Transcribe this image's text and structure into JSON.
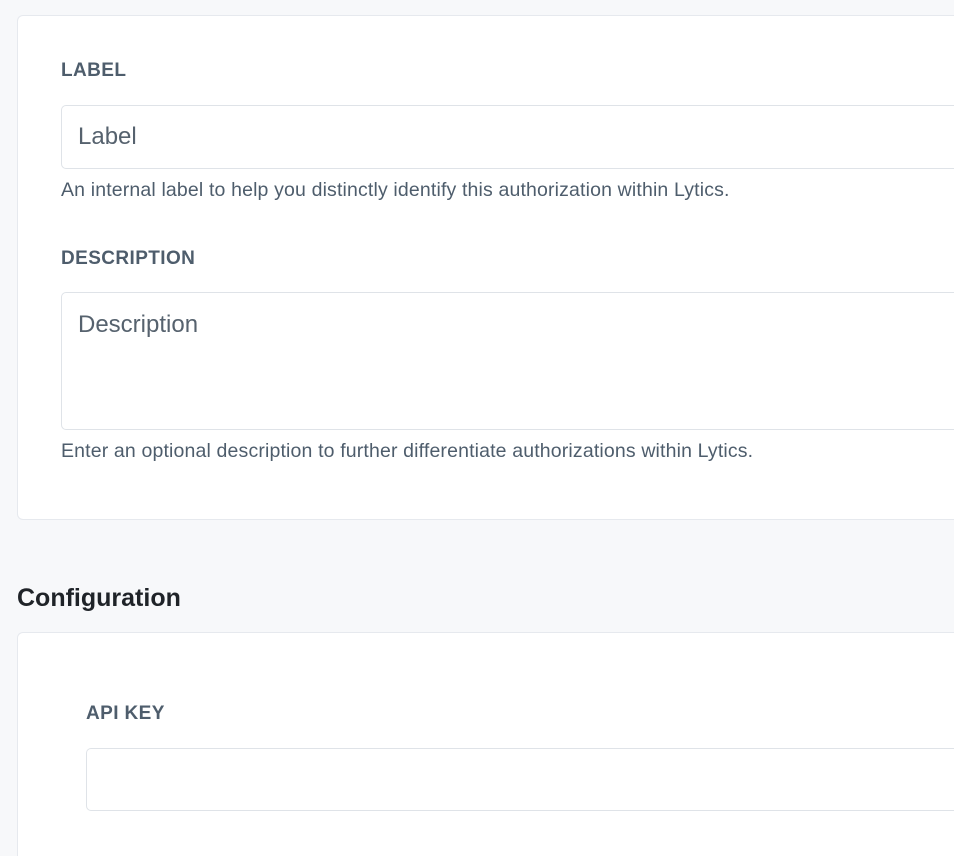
{
  "general": {
    "label": {
      "title": "LABEL",
      "placeholder": "Label",
      "value": "",
      "help": "An internal label to help you distinctly identify this authorization within Lytics."
    },
    "description": {
      "title": "DESCRIPTION",
      "placeholder": "Description",
      "value": "",
      "help": "Enter an optional description to further differentiate authorizations within Lytics."
    }
  },
  "configuration": {
    "heading": "Configuration",
    "api_key": {
      "title": "API KEY",
      "placeholder": "",
      "value": ""
    }
  },
  "colors": {
    "page_background": "#f7f8fa",
    "card_background": "#ffffff",
    "border": "#e6e9ee",
    "label_text": "#4e5d6c",
    "heading_text": "#1f2328"
  }
}
